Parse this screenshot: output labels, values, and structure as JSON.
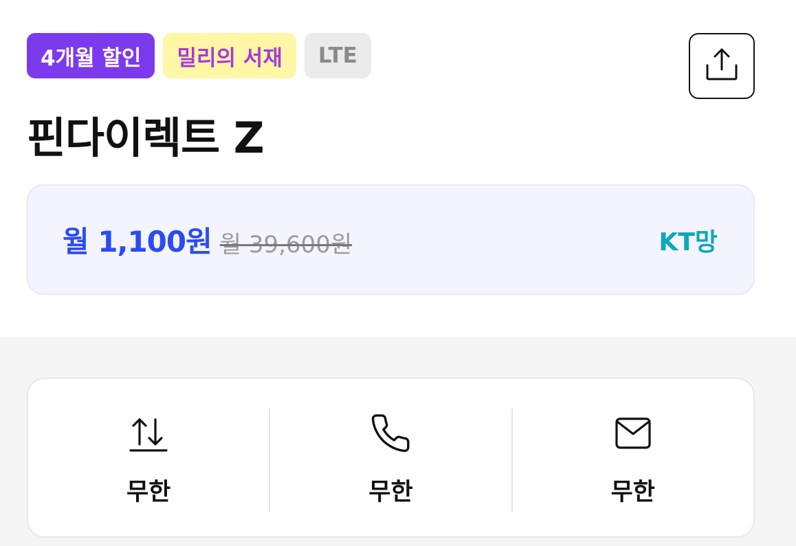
{
  "badges": {
    "discount": "4개월 할인",
    "millie": "밀리의 서재",
    "network_type": "LTE"
  },
  "share": {
    "icon": "share-icon"
  },
  "plan": {
    "title": "핀다이렉트 Z"
  },
  "price": {
    "current": "월 1,100원",
    "original": "월 39,600원",
    "network": "KT망"
  },
  "benefits": [
    {
      "icon": "data-transfer-icon",
      "value": "무한"
    },
    {
      "icon": "phone-icon",
      "value": "무한"
    },
    {
      "icon": "mail-icon",
      "value": "무한"
    }
  ],
  "colors": {
    "discount_badge_bg": "#7c3aed",
    "millie_badge_bg": "#fff6a6",
    "millie_badge_text": "#a43ad8",
    "price_current": "#2b4bf2",
    "network_text": "#0fa7b9",
    "price_card_bg": "#f3f4fe"
  }
}
